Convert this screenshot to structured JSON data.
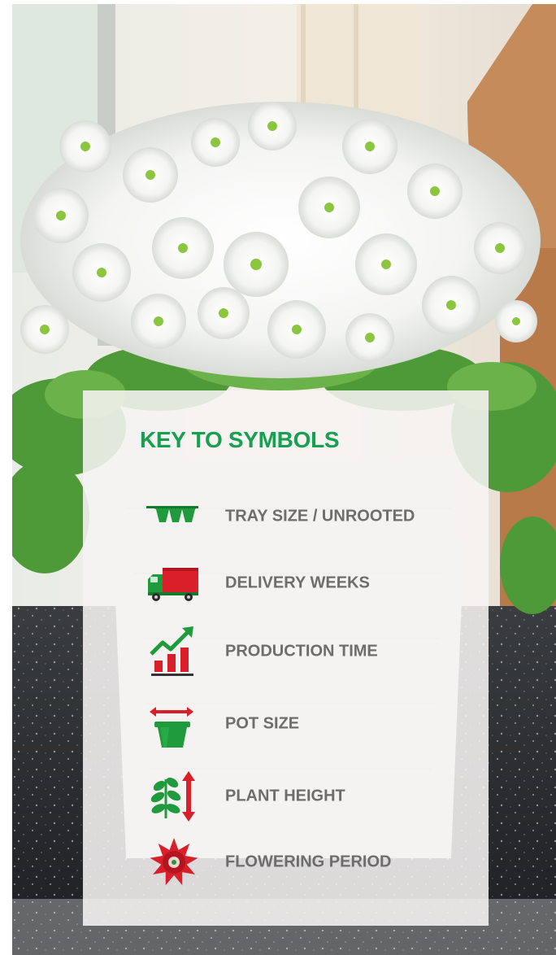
{
  "panel": {
    "title": "KEY TO SYMBOLS",
    "items": [
      {
        "label": "TRAY SIZE / UNROOTED",
        "icon": "tray-icon"
      },
      {
        "label": "DELIVERY WEEKS",
        "icon": "delivery-truck-icon"
      },
      {
        "label": "PRODUCTION TIME",
        "icon": "production-chart-icon"
      },
      {
        "label": "POT SIZE",
        "icon": "pot-size-icon"
      },
      {
        "label": "PLANT HEIGHT",
        "icon": "plant-height-icon"
      },
      {
        "label": "FLOWERING PERIOD",
        "icon": "flower-icon"
      }
    ]
  },
  "colors": {
    "title_green": "#17a050",
    "label_gray": "#6d6d6d",
    "icon_green": "#1f9a3c",
    "icon_red": "#d9202a"
  }
}
